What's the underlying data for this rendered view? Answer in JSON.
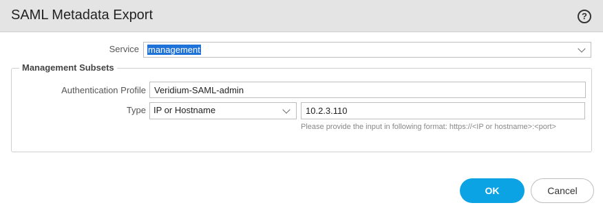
{
  "dialog": {
    "title": "SAML Metadata Export",
    "help_symbol": "?"
  },
  "service": {
    "label": "Service",
    "value": "management"
  },
  "management_subsets": {
    "legend": "Management Subsets",
    "auth_profile": {
      "label": "Authentication Profile",
      "value": "Veridium-SAML-admin"
    },
    "type": {
      "label": "Type",
      "selected": "IP or Hostname",
      "address_value": "10.2.3.110",
      "hint": "Please provide the input in following format: https://<IP or hostname>:<port>"
    }
  },
  "buttons": {
    "ok_label": "OK",
    "cancel_label": "Cancel"
  },
  "colors": {
    "accent": "#0ba3e4",
    "selection": "#1f73d8"
  },
  "icons": {
    "help": "help-icon",
    "dropdown": "chevron-down-icon"
  }
}
